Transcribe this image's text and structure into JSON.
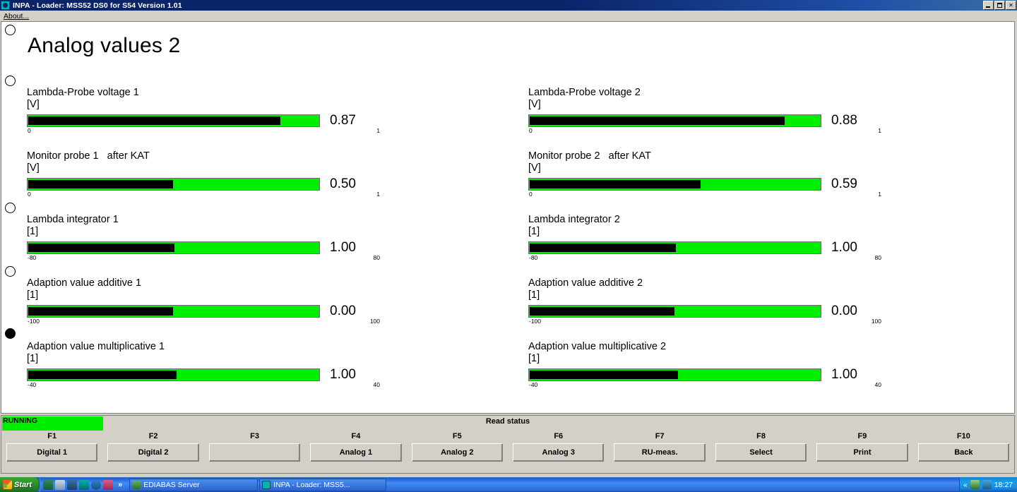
{
  "window": {
    "title": "INPA - Loader:  MSS52 DS0 for S54 Version 1.01",
    "icon": "inpa-globe-icon",
    "minimize_label": "",
    "maximize_label": "",
    "close_label": "✕"
  },
  "menu": {
    "about_label": "About..."
  },
  "page": {
    "title": "Analog values 2",
    "dots": [
      {
        "name": "page-dot-1",
        "active": false
      },
      {
        "name": "page-dot-2",
        "active": false
      },
      {
        "name": "page-dot-3",
        "active": false
      },
      {
        "name": "page-dot-4",
        "active": false
      },
      {
        "name": "page-dot-5",
        "active": false
      },
      {
        "name": "page-dot-6",
        "active": true
      }
    ]
  },
  "gauges": [
    {
      "label": "Lambda-Probe voltage 1",
      "unit": "[V]",
      "value": "0.87",
      "scale_min": "0",
      "scale_max": "1",
      "fill_percent": 87.0
    },
    {
      "label": "Monitor probe 1   after KAT",
      "unit": "[V]",
      "value": "0.50",
      "scale_min": "0",
      "scale_max": "1",
      "fill_percent": 50.0
    },
    {
      "label": "Lambda integrator 1",
      "unit": "[1]",
      "value": "1.00",
      "scale_min": "-80",
      "scale_max": "80",
      "fill_percent": 50.6
    },
    {
      "label": "Adaption value additive 1",
      "unit": "[1]",
      "value": "0.00",
      "scale_min": "-100",
      "scale_max": "100",
      "fill_percent": 50.0
    },
    {
      "label": "Adaption value multiplicative 1",
      "unit": "[1]",
      "value": "1.00",
      "scale_min": "-40",
      "scale_max": "40",
      "fill_percent": 51.3
    },
    {
      "label": "Lambda-Probe voltage 2",
      "unit": "[V]",
      "value": "0.88",
      "scale_min": "0",
      "scale_max": "1",
      "fill_percent": 88.0
    },
    {
      "label": "Monitor probe 2   after KAT",
      "unit": "[V]",
      "value": "0.59",
      "scale_min": "0",
      "scale_max": "1",
      "fill_percent": 59.0
    },
    {
      "label": "Lambda integrator 2",
      "unit": "[1]",
      "value": "1.00",
      "scale_min": "-80",
      "scale_max": "80",
      "fill_percent": 50.6
    },
    {
      "label": "Adaption value additive 2",
      "unit": "[1]",
      "value": "0.00",
      "scale_min": "-100",
      "scale_max": "100",
      "fill_percent": 50.0
    },
    {
      "label": "Adaption value multiplicative 2",
      "unit": "[1]",
      "value": "1.00",
      "scale_min": "-40",
      "scale_max": "40",
      "fill_percent": 51.3
    }
  ],
  "status": {
    "run_state": "RUNNING",
    "read_status": "Read status"
  },
  "function_keys": [
    {
      "key": "F1",
      "label": "Digital 1"
    },
    {
      "key": "F2",
      "label": "Digital 2"
    },
    {
      "key": "F3",
      "label": ""
    },
    {
      "key": "F4",
      "label": "Analog 1"
    },
    {
      "key": "F5",
      "label": "Analog 2"
    },
    {
      "key": "F6",
      "label": "Analog 3"
    },
    {
      "key": "F7",
      "label": "RU-meas."
    },
    {
      "key": "F8",
      "label": "Select"
    },
    {
      "key": "F9",
      "label": "Print"
    },
    {
      "key": "F10",
      "label": "Back"
    }
  ],
  "taskbar": {
    "start_label": "Start",
    "quicklaunch_chevron": "»",
    "tasks": [
      {
        "label": "EDIABAS Server",
        "icon": "ediabas-icon"
      },
      {
        "label": "INPA - Loader:  MSS5...",
        "icon": "inpa-globe-icon"
      }
    ],
    "tray": {
      "expand_chevron": "«",
      "clock": "18:27"
    }
  },
  "colors": {
    "bar_green": "#00ee00",
    "bar_fill": "#000000",
    "title_blue": "#0a246a",
    "face_gray": "#d4d0c8"
  }
}
